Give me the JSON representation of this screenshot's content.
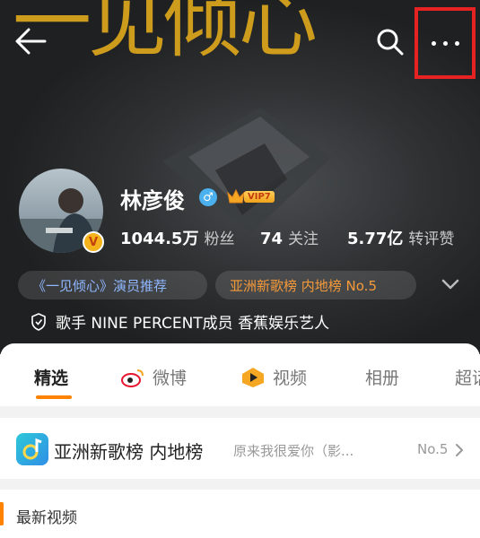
{
  "header": {
    "background_text": "一见倾心",
    "colors": {
      "background": "#232425",
      "title_art": "#d8a31c",
      "highlight_box": "#e62222"
    },
    "icons": {
      "back": "arrow-left-icon",
      "search": "search-icon",
      "more": "more-dots-icon"
    }
  },
  "profile": {
    "name": "林彦俊",
    "gender_symbol": "♂",
    "verified_badge": "V",
    "vip_label": "VIP7",
    "stats": [
      {
        "value": "1044.5万",
        "label": "粉丝"
      },
      {
        "value": "74",
        "label": "关注"
      },
      {
        "value": "5.77亿",
        "label": "转评赞"
      }
    ],
    "pills": [
      {
        "text": "《一见倾心》演员推荐"
      },
      {
        "text": "亚洲新歌榜 内地榜 No.5"
      }
    ],
    "description": "歌手 NINE PERCENT成员 香蕉娱乐艺人"
  },
  "tabs": [
    {
      "label": "精选",
      "active": true
    },
    {
      "label": "微博",
      "icon": "weibo-icon"
    },
    {
      "label": "视频",
      "icon": "video-icon"
    },
    {
      "label": "相册"
    },
    {
      "label": "超话"
    }
  ],
  "chart_row": {
    "title": "亚洲新歌榜 内地榜",
    "song": "原来我很爱你（影...",
    "rank": "No.5"
  },
  "section": {
    "latest_videos": "最新视频"
  },
  "accent": "#ff8200"
}
